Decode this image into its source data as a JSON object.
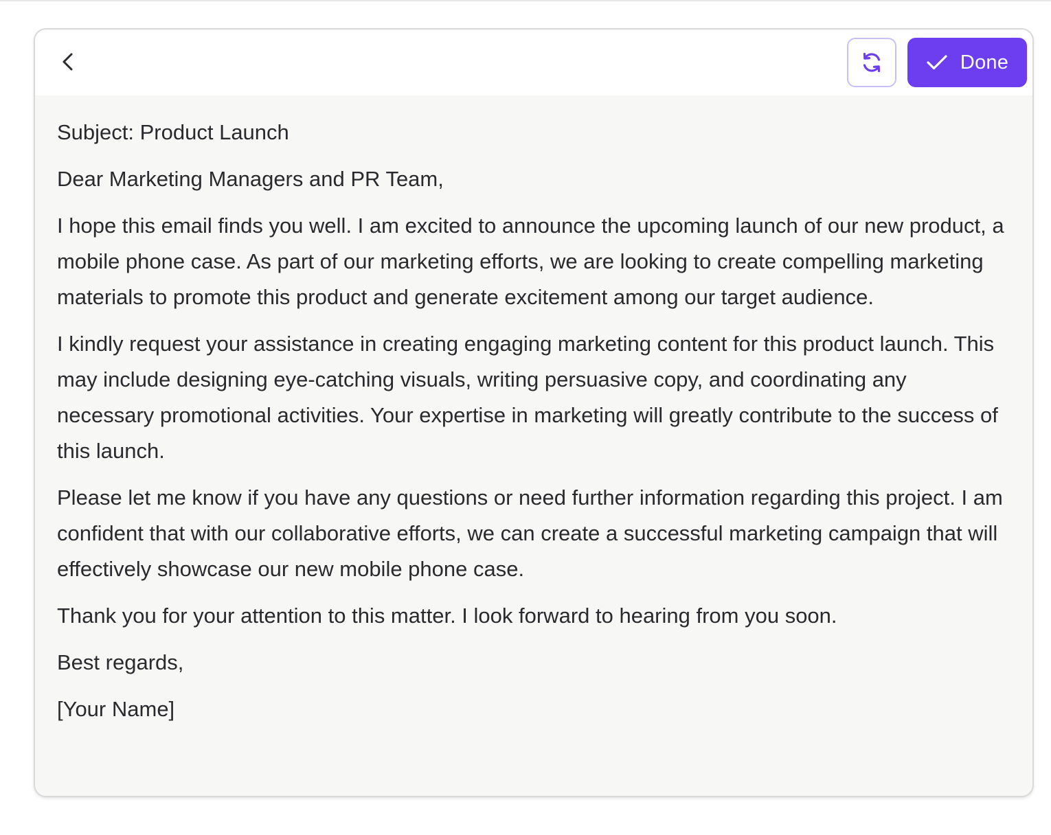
{
  "header": {
    "done_label": "Done"
  },
  "icons": {
    "back": "chevron-left-icon",
    "refresh": "refresh-icon",
    "done": "check-icon"
  },
  "colors": {
    "accent": "#6c3ef0",
    "accent_border": "#c9bff5",
    "body_text": "#2a2a2e",
    "card_background": "#f7f7f6"
  },
  "email": {
    "subject": "Subject: Product Launch",
    "greeting": "Dear Marketing Managers and PR Team,",
    "paragraphs": [
      "I hope this email finds you well. I am excited to announce the upcoming launch of our new product, a mobile phone case. As part of our marketing efforts, we are looking to create compelling marketing materials to promote this product and generate excitement among our target audience.",
      "I kindly request your assistance in creating engaging marketing content for this product launch. This may include designing eye-catching visuals, writing persuasive copy, and coordinating any necessary promotional activities. Your expertise in marketing will greatly contribute to the success of this launch.",
      "Please let me know if you have any questions or need further information regarding this project. I am confident that with our collaborative efforts, we can create a successful marketing campaign that will effectively showcase our new mobile phone case.",
      "Thank you for your attention to this matter. I look forward to hearing from you soon."
    ],
    "closing": "Best regards,",
    "signature": "[Your Name]"
  }
}
